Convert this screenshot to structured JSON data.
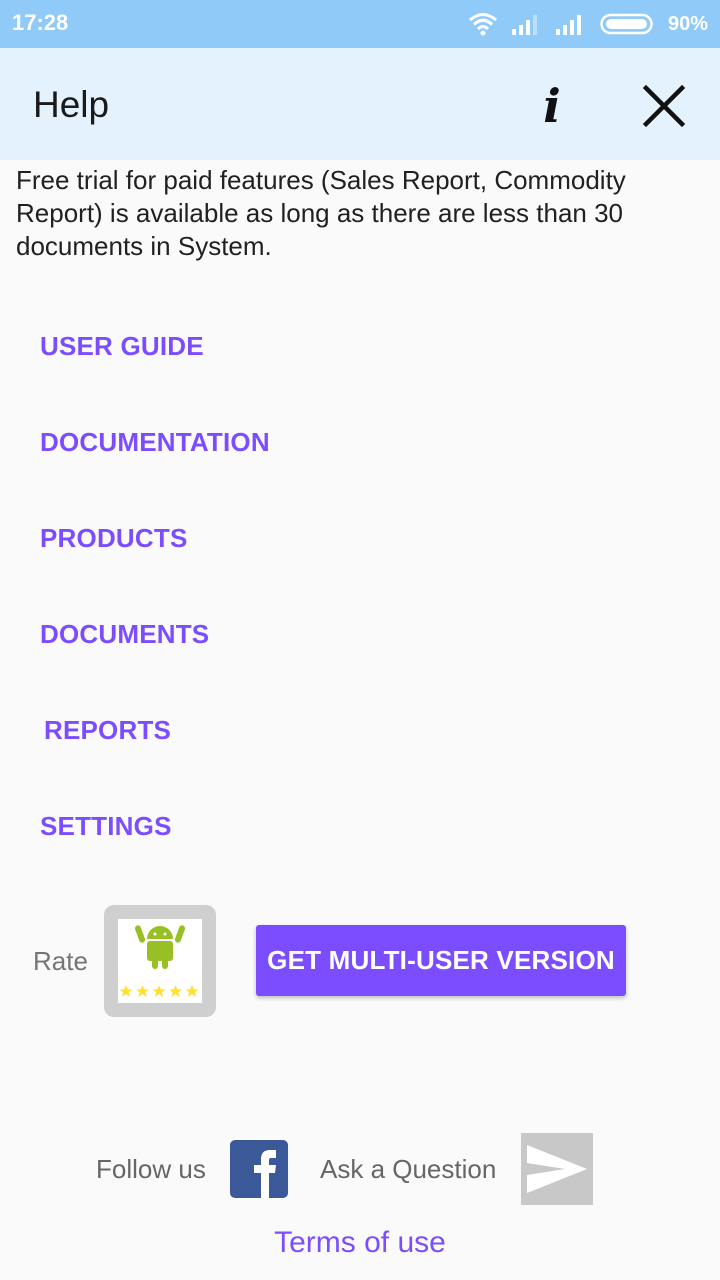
{
  "status_bar": {
    "time": "17:28",
    "battery_percent": "90%",
    "icons": [
      "wifi-icon",
      "signal-weak-icon",
      "signal-icon",
      "battery-icon"
    ]
  },
  "app_bar": {
    "title": "Help",
    "info_icon": "info-icon",
    "close_icon": "close-icon"
  },
  "intro_text": "Free trial for paid features (Sales Report, Commodity Report) is available as long as there are less than 30 documents in System.",
  "nav_links": [
    {
      "label": "USER GUIDE"
    },
    {
      "label": "DOCUMENTATION"
    },
    {
      "label": "PRODUCTS"
    },
    {
      "label": "DOCUMENTS"
    },
    {
      "label": "REPORTS"
    },
    {
      "label": "SETTINGS"
    }
  ],
  "rate": {
    "label": "Rate",
    "icon": "android-rate-icon",
    "stars": 5
  },
  "multi_user_button": "GET MULTI-USER VERSION",
  "footer": {
    "follow_label": "Follow us",
    "facebook_icon": "facebook-icon",
    "ask_label": "Ask a Question",
    "send_icon": "send-icon",
    "terms_label": "Terms of use"
  },
  "colors": {
    "accent": "#7c4dff",
    "status_bar": "#90caf9",
    "app_bar": "#e3f2fd",
    "facebook": "#3b5998"
  }
}
